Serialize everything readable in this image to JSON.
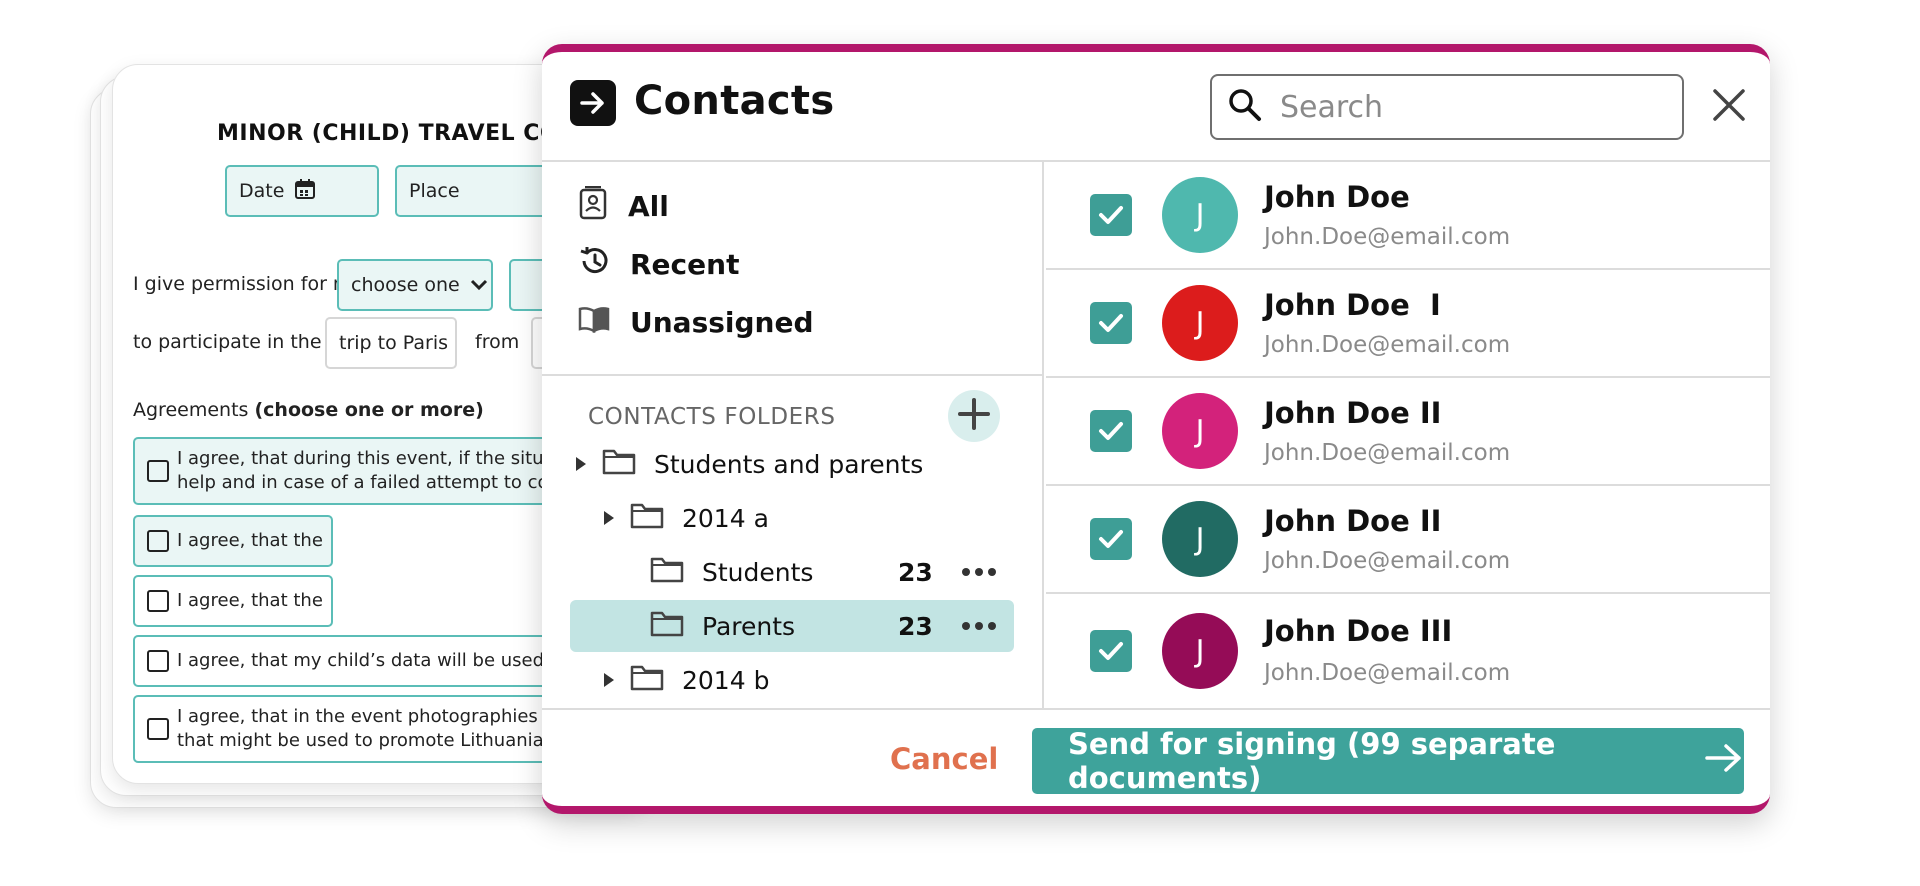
{
  "document": {
    "title": "MINOR (CHILD) TRAVEL CON",
    "date_label": "Date",
    "place_label": "Place",
    "permission_text": "I give permission for my",
    "choose_one": "choose one",
    "participate_text": "to participate in the",
    "trip_value": "trip to Paris",
    "from_text": "from",
    "agreements_label": "Agreements",
    "agreements_hint": "(choose one or more)",
    "agreements": [
      {
        "line1": "I agree, that during this event, if the situ",
        "line2": "help and in case of a failed attempt to co"
      },
      {
        "line1": "I agree, that the",
        "line2": ""
      },
      {
        "line1": "I agree, that the",
        "line2": ""
      },
      {
        "line1": "I agree, that my child’s data will be used",
        "line2": ""
      },
      {
        "line1": "I agree, that in the event photographies c",
        "line2": "that might be used to promote Lithuania"
      }
    ]
  },
  "modal": {
    "title": "Contacts",
    "search_placeholder": "Search",
    "nav": [
      {
        "label": "All",
        "icon": "contact-book-icon"
      },
      {
        "label": "Recent",
        "icon": "history-icon"
      },
      {
        "label": "Unassigned",
        "icon": "open-book-icon"
      }
    ],
    "folders_label": "CONTACTS FOLDERS",
    "tree": [
      {
        "label": "Students and parents",
        "count": "",
        "expandable": true
      },
      {
        "label": "2014 a",
        "count": "",
        "expandable": true
      },
      {
        "label": "Students",
        "count": "23",
        "expandable": false
      },
      {
        "label": "Parents",
        "count": "23",
        "expandable": false,
        "selected": true
      },
      {
        "label": "2014 b",
        "count": "",
        "expandable": true
      }
    ],
    "contacts": [
      {
        "name": "John Doe",
        "email": "John.Doe@email.com",
        "initial": "J",
        "color": "#4fb8ae",
        "checked": true
      },
      {
        "name": "John Doe  I",
        "email": "John.Doe@email.com",
        "initial": "J",
        "color": "#dc1c1c",
        "checked": true
      },
      {
        "name": "John Doe II",
        "email": "John.Doe@email.com",
        "initial": "J",
        "color": "#d3227b",
        "checked": true
      },
      {
        "name": "John Doe II",
        "email": "John.Doe@email.com",
        "initial": "J",
        "color": "#216b63",
        "checked": true
      },
      {
        "name": "John Doe III",
        "email": "John.Doe@email.com",
        "initial": "J",
        "color": "#950c57",
        "checked": true
      }
    ],
    "cancel_label": "Cancel",
    "send_label": "Send for signing (99 separate documents)"
  },
  "colors": {
    "accent_teal": "#3ea39b",
    "brand_magenta": "#b3176b",
    "cancel_orange": "#e0714e"
  }
}
